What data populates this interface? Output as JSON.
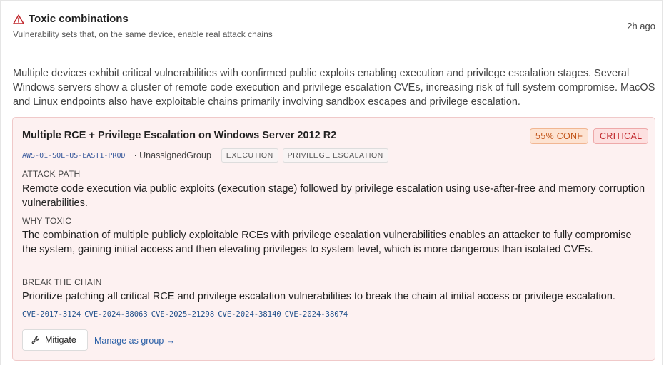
{
  "header": {
    "title": "Toxic combinations",
    "subtitle": "Vulnerability sets that, on the same device, enable real attack chains",
    "timestamp": "2h ago",
    "icon": "warning-triangle-icon"
  },
  "summary": "Multiple devices exhibit critical vulnerabilities with confirmed public exploits enabling execution and privilege escalation stages. Several Windows servers show a cluster of remote code execution and privilege escalation CVEs, increasing risk of full system compromise. MacOS and Linux endpoints also have exploitable chains primarily involving sandbox escapes and privilege escalation.",
  "card": {
    "title": "Multiple RCE + Privilege Escalation on Windows Server 2012 R2",
    "confidence": "55% CONF",
    "severity": "CRITICAL",
    "device": "AWS-01-SQL-US-EAST1-PROD",
    "group": "· UnassignedGroup",
    "tags": [
      "EXECUTION",
      "PRIVILEGE ESCALATION"
    ],
    "attack_path_label": "ATTACK PATH",
    "attack_path": "Remote code execution via public exploits (execution stage) followed by privilege escalation using use-after-free and memory corruption vulnerabilities.",
    "why_toxic_label": "WHY TOXIC",
    "why_toxic": "The combination of multiple publicly exploitable RCEs with privilege escalation vulnerabilities enables an attacker to fully compromise the system, gaining initial access and then elevating privileges to system level, which is more dangerous than isolated CVEs.",
    "break_chain_label": "BREAK THE CHAIN",
    "break_chain": "Prioritize patching all critical RCE and privilege escalation vulnerabilities to break the chain at initial access or privilege escalation.",
    "cves": [
      "CVE-2017-3124",
      "CVE-2024-38063",
      "CVE-2025-21298",
      "CVE-2024-38140",
      "CVE-2024-38074"
    ],
    "mitigate_label": "Mitigate",
    "manage_label": "Manage as group →"
  },
  "colors": {
    "warning": "#c0262b",
    "conf_text": "#c2551a",
    "severity_text": "#c0262b",
    "card_bg": "#fdf1f1",
    "link": "#2a5fa6"
  }
}
